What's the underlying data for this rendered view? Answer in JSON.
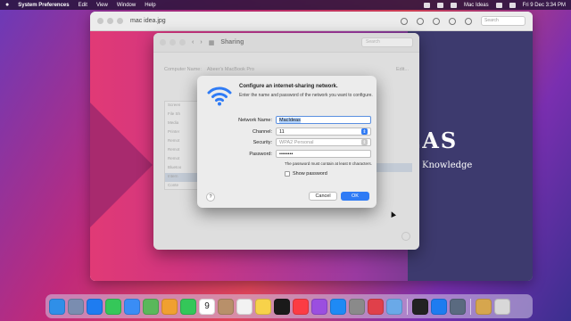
{
  "menubar": {
    "apple_icon": "apple-icon",
    "app_name": "System Preferences",
    "menus": [
      "Edit",
      "View",
      "Window",
      "Help"
    ],
    "user": "Mac Ideas",
    "clock": "Fri 9 Dec  3:34 PM"
  },
  "preview": {
    "filename": "mac idea.jpg",
    "search_placeholder": "Search",
    "brand_text": "EAS",
    "brand_sub": "Knowledge"
  },
  "sharing": {
    "title": "Sharing",
    "search_placeholder": "Search",
    "computer_name_label": "Computer Name:",
    "computer_name_value": "Abeer's MacBook Pro",
    "edit_label": "Edit...",
    "list_items": [
      "Screen",
      "File Sh",
      "Media",
      "Printer",
      "Remot",
      "Remot",
      "Remot",
      "Bluetoo",
      "Intern",
      "Conte"
    ],
    "selected_index": 8
  },
  "dialog": {
    "title": "Configure an internet-sharing network.",
    "description": "Enter the name and password of the network you want to configure.",
    "network_name_label": "Network Name:",
    "network_name_value": "MacIdeas",
    "channel_label": "Channel:",
    "channel_value": "11",
    "security_label": "Security:",
    "security_value": "WPA2 Personal",
    "password_label": "Password:",
    "password_value": "••••••••",
    "password_hint": "The password must contain at least 8 characters.",
    "show_password_label": "Show password",
    "help_label": "?",
    "cancel_label": "Cancel",
    "ok_label": "OK",
    "colors": {
      "accent": "#2f7bf5",
      "selection": "#b3d4ff"
    }
  },
  "dock": {
    "icons": [
      {
        "name": "finder-icon",
        "color": "#2f8fe8"
      },
      {
        "name": "launchpad-icon",
        "color": "#7a8db0"
      },
      {
        "name": "safari-icon",
        "color": "#1e7cf0"
      },
      {
        "name": "messages-icon",
        "color": "#35c759"
      },
      {
        "name": "mail-icon",
        "color": "#3a8df5"
      },
      {
        "name": "maps-icon",
        "color": "#5ab85a"
      },
      {
        "name": "photos-icon",
        "color": "#f0a030"
      },
      {
        "name": "facetime-icon",
        "color": "#34c759"
      },
      {
        "name": "calendar-icon",
        "color": "#ffffff"
      },
      {
        "name": "contacts-icon",
        "color": "#b8906a"
      },
      {
        "name": "reminders-icon",
        "color": "#f2f2f2"
      },
      {
        "name": "notes-icon",
        "color": "#f7d24a"
      },
      {
        "name": "appletv-icon",
        "color": "#1a1a1a"
      },
      {
        "name": "music-icon",
        "color": "#fc3c44"
      },
      {
        "name": "podcasts-icon",
        "color": "#9b4ee0"
      },
      {
        "name": "appstore-icon",
        "color": "#1e8af5"
      },
      {
        "name": "system-preferences-icon",
        "color": "#8a8a8a"
      },
      {
        "name": "speedtest-icon",
        "color": "#e0404a"
      },
      {
        "name": "preview-icon",
        "color": "#6aa9e8"
      },
      {
        "name": "terminal-icon",
        "color": "#222222"
      },
      {
        "name": "bluetooth-icon",
        "color": "#1e7cf0"
      },
      {
        "name": "screenshot-icon",
        "color": "#5a6a80"
      },
      {
        "name": "archive-icon",
        "color": "#d6a64e"
      },
      {
        "name": "trash-icon",
        "color": "#d8d8d8"
      }
    ],
    "calendar_day": "9"
  }
}
